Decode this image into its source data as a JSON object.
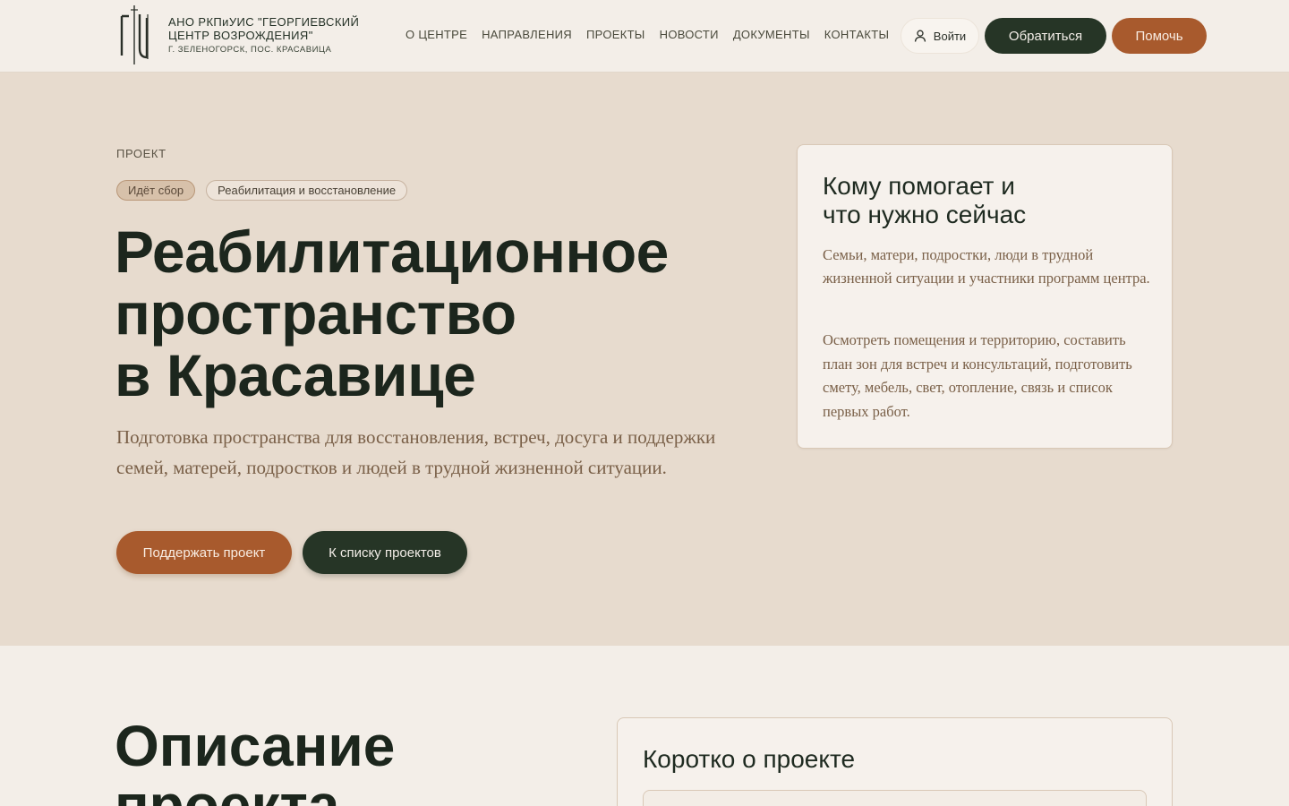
{
  "header": {
    "org_line1": "АНО РКПиУИС \"ГЕОРГИЕВСКИЙ",
    "org_line2": "ЦЕНТР ВОЗРОЖДЕНИЯ\"",
    "org_location": "Г. ЗЕЛЕНОГОРСК, ПОС. КРАСАВИЦА",
    "nav": [
      "О ЦЕНТРЕ",
      "НАПРАВЛЕНИЯ",
      "ПРОЕКТЫ",
      "НОВОСТИ",
      "ДОКУМЕНТЫ",
      "КОНТАКТЫ"
    ],
    "login_label": "Войти",
    "contact_label": "Обратиться",
    "help_label": "Помочь"
  },
  "hero": {
    "eyebrow": "ПРОЕКТ",
    "status_pill": "Идёт сбор",
    "category_pill": "Реабилитация и восстановление",
    "title_line1": "Реабилитационное",
    "title_line2": "пространство",
    "title_line3": "в Красавице",
    "lead": "Подготовка пространства для восстановления, встреч, досуга и поддержки семей, матерей, подростков и людей в трудной жизненной ситуации.",
    "support_label": "Поддержать проект",
    "list_label": "К списку проектов"
  },
  "help_card": {
    "title_line1": "Кому помогает и",
    "title_line2": "что нужно сейчас",
    "who": "Семьи, матери, подростки, люди в трудной жизненной ситуации и участники программ центра.",
    "needs": "Осмотреть помещения и территорию, составить план зон для встреч и консультаций, подготовить смету, мебель, свет, отопление, связь и список первых работ."
  },
  "description": {
    "title_line1": "Описание",
    "title_line2": "проекта",
    "brief_title": "Коротко о проекте"
  },
  "colors": {
    "accent": "#a85a2d",
    "dark": "#263526",
    "hero_bg": "#e7dbce",
    "page_bg": "#f3eee8"
  }
}
